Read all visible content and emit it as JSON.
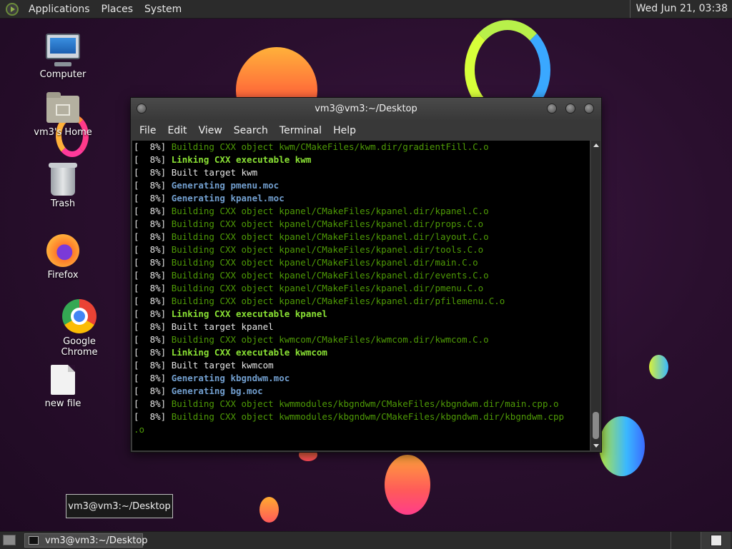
{
  "top_panel": {
    "menus": [
      "Applications",
      "Places",
      "System"
    ],
    "clock": "Wed Jun 21, 03:38"
  },
  "desktop_icons": [
    {
      "label": "Computer",
      "icon": "computer-icon"
    },
    {
      "label": "vm3's Home",
      "icon": "home-folder-icon"
    },
    {
      "label": "Trash",
      "icon": "trash-icon"
    },
    {
      "label": "Firefox",
      "icon": "firefox-icon"
    },
    {
      "label": "Google Chrome",
      "icon": "chrome-icon"
    },
    {
      "label": "new file",
      "icon": "file-icon"
    }
  ],
  "terminal": {
    "title": "vm3@vm3:~/Desktop",
    "menu": [
      "File",
      "Edit",
      "View",
      "Search",
      "Terminal",
      "Help"
    ],
    "lines": [
      {
        "prefix": "[  8%] ",
        "text": "Building CXX object kwm/CMakeFiles/kwm.dir/gradientFill.C.o",
        "style": "g"
      },
      {
        "prefix": "[  8%] ",
        "text": "Linking CXX executable kwm",
        "style": "gb"
      },
      {
        "prefix": "[  8%] ",
        "text": "Built target kwm",
        "style": "w"
      },
      {
        "prefix": "[  8%] ",
        "text": "Generating pmenu.moc",
        "style": "bb"
      },
      {
        "prefix": "[  8%] ",
        "text": "Generating kpanel.moc",
        "style": "bb"
      },
      {
        "prefix": "[  8%] ",
        "text": "Building CXX object kpanel/CMakeFiles/kpanel.dir/kpanel.C.o",
        "style": "g"
      },
      {
        "prefix": "[  8%] ",
        "text": "Building CXX object kpanel/CMakeFiles/kpanel.dir/props.C.o",
        "style": "g"
      },
      {
        "prefix": "[  8%] ",
        "text": "Building CXX object kpanel/CMakeFiles/kpanel.dir/layout.C.o",
        "style": "g"
      },
      {
        "prefix": "[  8%] ",
        "text": "Building CXX object kpanel/CMakeFiles/kpanel.dir/tools.C.o",
        "style": "g"
      },
      {
        "prefix": "[  8%] ",
        "text": "Building CXX object kpanel/CMakeFiles/kpanel.dir/main.C.o",
        "style": "g"
      },
      {
        "prefix": "[  8%] ",
        "text": "Building CXX object kpanel/CMakeFiles/kpanel.dir/events.C.o",
        "style": "g"
      },
      {
        "prefix": "[  8%] ",
        "text": "Building CXX object kpanel/CMakeFiles/kpanel.dir/pmenu.C.o",
        "style": "g"
      },
      {
        "prefix": "[  8%] ",
        "text": "Building CXX object kpanel/CMakeFiles/kpanel.dir/pfilemenu.C.o",
        "style": "g"
      },
      {
        "prefix": "[  8%] ",
        "text": "Linking CXX executable kpanel",
        "style": "gb"
      },
      {
        "prefix": "[  8%] ",
        "text": "Built target kpanel",
        "style": "w"
      },
      {
        "prefix": "[  8%] ",
        "text": "Building CXX object kwmcom/CMakeFiles/kwmcom.dir/kwmcom.C.o",
        "style": "g"
      },
      {
        "prefix": "[  8%] ",
        "text": "Linking CXX executable kwmcom",
        "style": "gb"
      },
      {
        "prefix": "[  8%] ",
        "text": "Built target kwmcom",
        "style": "w"
      },
      {
        "prefix": "[  8%] ",
        "text": "Generating kbgndwm.moc",
        "style": "bb"
      },
      {
        "prefix": "[  8%] ",
        "text": "Generating bg.moc",
        "style": "bb"
      },
      {
        "prefix": "[  8%] ",
        "text": "Building CXX object kwmmodules/kbgndwm/CMakeFiles/kbgndwm.dir/main.cpp.o",
        "style": "g"
      },
      {
        "prefix": "[  8%] ",
        "text": "Building CXX object kwmmodules/kbgndwm/CMakeFiles/kbgndwm.dir/kbgndwm.cpp",
        "style": "g"
      },
      {
        "prefix": "",
        "text": ".o",
        "style": "g"
      }
    ]
  },
  "tooltip": "vm3@vm3:~/Desktop",
  "taskbar": {
    "task_label": "vm3@vm3:~/Desktop"
  }
}
